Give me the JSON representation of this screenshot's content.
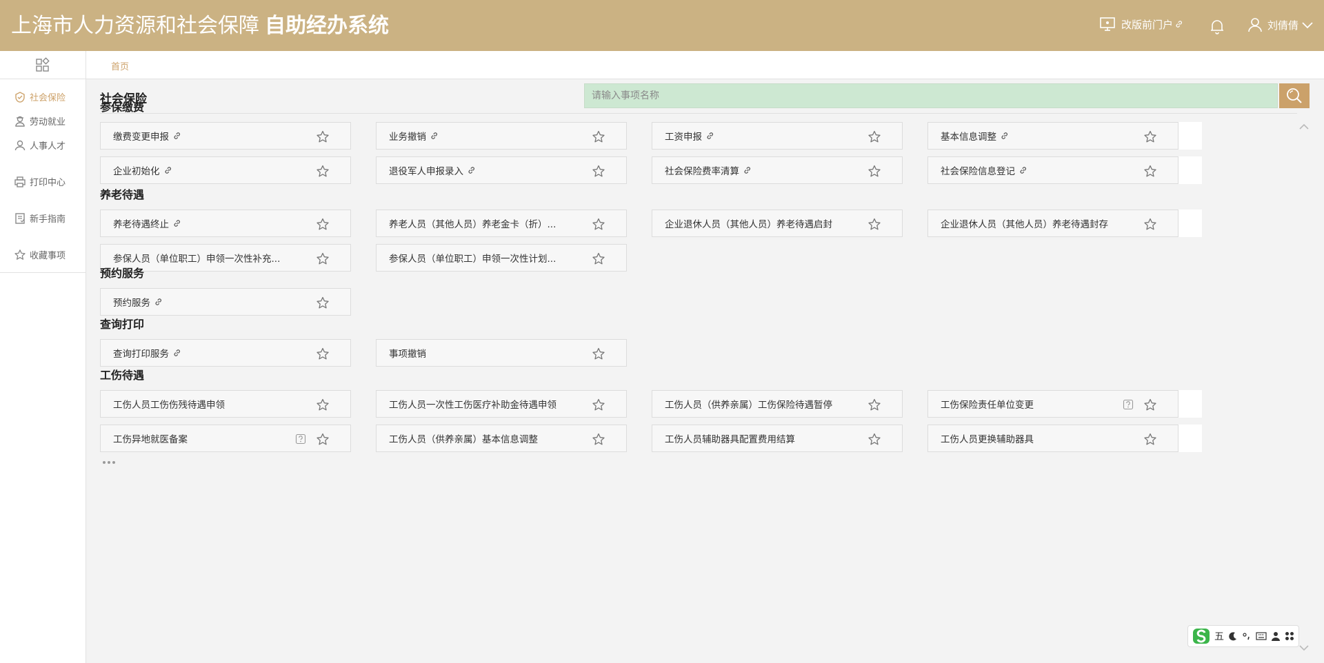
{
  "header": {
    "title": "上海市人力资源和社会保障",
    "system_name": "自助经办系统",
    "portal_link": "改版前门户",
    "user_name": "刘倩倩"
  },
  "sidebar": {
    "items": [
      {
        "label": "社会保险",
        "icon": "shield-icon",
        "active": true
      },
      {
        "label": "劳动就业",
        "icon": "worker-icon"
      },
      {
        "label": "人事人才",
        "icon": "person-icon"
      },
      {
        "label": "打印中心",
        "icon": "printer-icon"
      },
      {
        "label": "新手指南",
        "icon": "guide-icon"
      },
      {
        "label": "收藏事项",
        "icon": "star-icon"
      }
    ]
  },
  "breadcrumb": {
    "home": "首页"
  },
  "main": {
    "title": "社会保险",
    "search_placeholder": "请输入事项名称"
  },
  "sections": [
    {
      "title": "参保缴费",
      "more": true,
      "items": [
        {
          "label": "缴费变更申报",
          "link": true
        },
        {
          "label": "业务撤销",
          "link": true
        },
        {
          "label": "工资申报",
          "link": true
        },
        {
          "label": "基本信息调整",
          "link": true
        },
        {
          "label": "企业初始化",
          "link": true
        },
        {
          "label": "退役军人申报录入",
          "link": true
        },
        {
          "label": "社会保险费率清算",
          "link": true
        },
        {
          "label": "社会保险信息登记",
          "link": true
        }
      ]
    },
    {
      "title": "养老待遇",
      "items": [
        {
          "label": "养老待遇终止",
          "link": true
        },
        {
          "label": "养老人员（其他人员）养老金卡（折）..."
        },
        {
          "label": "企业退休人员（其他人员）养老待遇启封"
        },
        {
          "label": "企业退休人员（其他人员）养老待遇封存"
        },
        {
          "label": "参保人员（单位职工）申领一次性补充..."
        },
        {
          "label": "参保人员（单位职工）申领一次性计划..."
        }
      ]
    },
    {
      "title": "预约服务",
      "items": [
        {
          "label": "预约服务",
          "link": true
        }
      ]
    },
    {
      "title": "查询打印",
      "items": [
        {
          "label": "查询打印服务",
          "link": true
        },
        {
          "label": "事项撤销"
        }
      ]
    },
    {
      "title": "工伤待遇",
      "more": true,
      "items": [
        {
          "label": "工伤人员工伤伤残待遇申领"
        },
        {
          "label": "工伤人员一次性工伤医疗补助金待遇申领"
        },
        {
          "label": "工伤人员（供养亲属）工伤保险待遇暂停"
        },
        {
          "label": "工伤保险责任单位变更",
          "help": true
        },
        {
          "label": "工伤异地就医备案",
          "help": true
        },
        {
          "label": "工伤人员（供养亲属）基本信息调整"
        },
        {
          "label": "工伤人员辅助器具配置费用结算"
        },
        {
          "label": "工伤人员更换辅助器具"
        }
      ]
    }
  ],
  "ime": {
    "mode": "五"
  },
  "colors": {
    "header_bg": "#cbb283",
    "accent": "#cda26a",
    "search_bg": "#cde8d2"
  }
}
